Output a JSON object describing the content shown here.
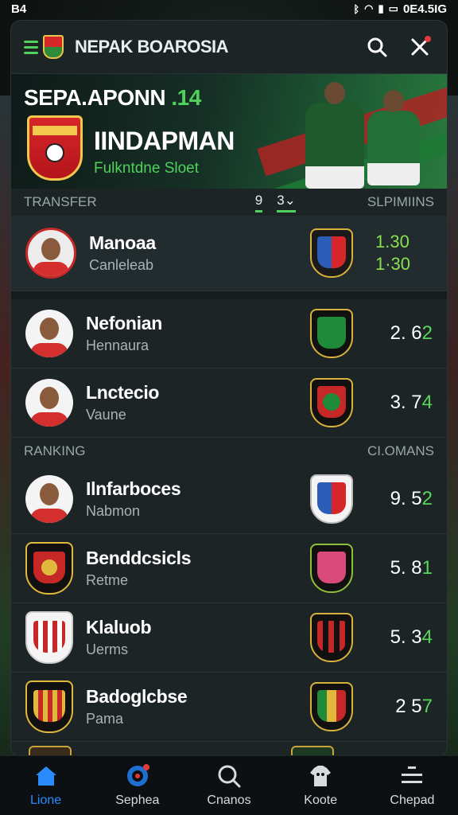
{
  "status_bar": {
    "time": "B4",
    "right_text": "0E4.5IG",
    "icons": [
      "bluetooth-icon",
      "wifi-icon",
      "signal-icon",
      "battery-icon"
    ]
  },
  "header": {
    "title": "NEPAK BOAROSIA"
  },
  "hero": {
    "title": "SEPA.APONN",
    "title_accent": ".14",
    "name": "IINDAPMAN",
    "subtitle": "Fulkntdne Sloet"
  },
  "transfer": {
    "title": "TRANSFER",
    "tabs": [
      "9",
      "3⌄"
    ],
    "right_label": "SLPIMIINS",
    "rows": [
      {
        "name": "Manoaa",
        "club": "Canleleab",
        "score_top": "1.30",
        "score_bottom": "1·30"
      },
      {
        "name": "Nefonian",
        "club": "Hennaura",
        "score_main": "2. 6",
        "score_accent": "2"
      },
      {
        "name": "Lnctecio",
        "club": "Vaune",
        "score_main": "3. 7",
        "score_accent": "4"
      }
    ]
  },
  "ranking": {
    "title": "RANKING",
    "right_label": "CI.OMANS",
    "rows": [
      {
        "name": "Ilnfarboces",
        "club": "Nabmon",
        "score_main": "9. 5",
        "score_accent": "2"
      },
      {
        "name": "Benddcsicls",
        "club": "Retme",
        "score_main": "5. 8",
        "score_accent": "1"
      },
      {
        "name": "Klaluob",
        "club": "Uerms",
        "score_main": "5. 3",
        "score_accent": "4"
      },
      {
        "name": "Badoglcbse",
        "club": "Pama",
        "score_main": "2 5",
        "score_accent": "7"
      }
    ]
  },
  "bottom_nav": [
    {
      "label": "Lione",
      "icon": "home-icon"
    },
    {
      "label": "Sephea",
      "icon": "target-icon"
    },
    {
      "label": "Cnanos",
      "icon": "search-icon"
    },
    {
      "label": "Koote",
      "icon": "jersey-icon"
    },
    {
      "label": "Chepad",
      "icon": "menu-icon"
    }
  ],
  "colors": {
    "accent_green": "#4fd15b",
    "nav_active": "#2a8bff",
    "panel": "#1c2426"
  }
}
